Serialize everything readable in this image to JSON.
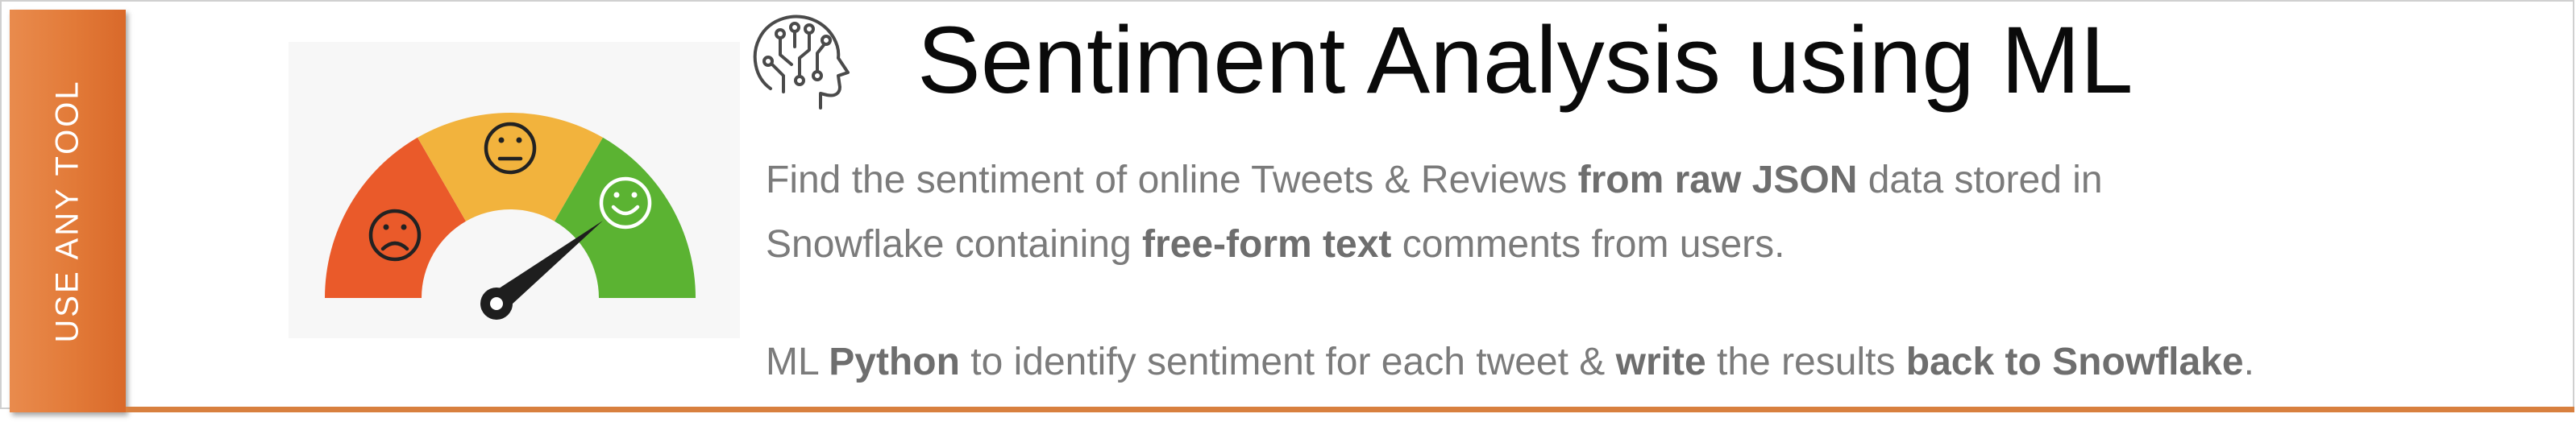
{
  "side_tab": {
    "label": "USE ANY TOOL"
  },
  "title": "Sentiment Analysis using ML",
  "description": {
    "line1": [
      {
        "text": "Find the sentiment of online Tweets & Reviews ",
        "bold": false
      },
      {
        "text": "from raw JSON",
        "bold": true
      },
      {
        "text": " data stored in",
        "bold": false
      }
    ],
    "line2": [
      {
        "text": "Snowflake containing ",
        "bold": false
      },
      {
        "text": "free-form text",
        "bold": true
      },
      {
        "text": " comments from users.",
        "bold": false
      }
    ],
    "line3": [
      {
        "text": "ML ",
        "bold": false
      },
      {
        "text": "Python",
        "bold": true
      },
      {
        "text": " to identify sentiment for each tweet & ",
        "bold": false
      },
      {
        "text": "write",
        "bold": true
      },
      {
        "text": " the results ",
        "bold": false
      },
      {
        "text": "back to Snowflake",
        "bold": true
      },
      {
        "text": ".",
        "bold": false
      }
    ]
  },
  "gauge": {
    "segments": [
      {
        "name": "negative",
        "color": "#ea5a2a",
        "face": "sad"
      },
      {
        "name": "neutral",
        "color": "#f2b33d",
        "face": "neutral"
      },
      {
        "name": "positive",
        "color": "#5bb332",
        "face": "happy"
      }
    ],
    "needle_color": "#1e1e1e"
  },
  "colors": {
    "accent": "#e27a38",
    "rule": "#d8803f",
    "text": "#7b7b7b",
    "title": "#0a0a0a"
  },
  "icons": [
    "brain-circuit-icon"
  ]
}
